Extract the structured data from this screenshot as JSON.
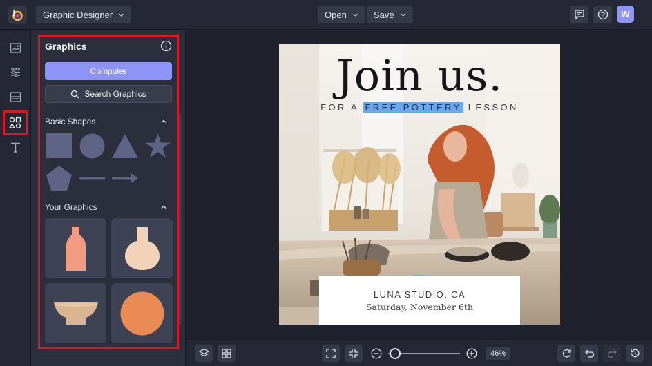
{
  "topbar": {
    "app_name": "Graphic Designer",
    "open_label": "Open",
    "save_label": "Save",
    "avatar_initial": "W"
  },
  "rail": {
    "items": [
      "image-icon",
      "sliders-icon",
      "layout-icon",
      "shapes-icon",
      "text-icon"
    ],
    "active_item": "shapes-icon"
  },
  "panel": {
    "title": "Graphics",
    "computer_button": "Computer",
    "search_button": "Search Graphics",
    "basic_shapes_title": "Basic Shapes",
    "basic_shapes": [
      "square",
      "circle",
      "triangle",
      "star",
      "pentagon",
      "line",
      "arrow"
    ],
    "your_graphics_title": "Your Graphics",
    "your_graphics": [
      "bottle-vase",
      "round-vase",
      "bowl",
      "circle-orange"
    ]
  },
  "design": {
    "headline": "Join us.",
    "sub_prefix": "FOR A",
    "sub_highlight": "FREE POTTERY",
    "sub_suffix": "LESSON",
    "card_line1": "LUNA STUDIO, CA",
    "card_line2": "Saturday, November 6th"
  },
  "bottombar": {
    "zoom": "46%"
  },
  "colors": {
    "accent": "#8d93f7",
    "highlight": "#6aa8ee",
    "shape_fill": "#5f6385",
    "annotation_red": "#e3141b"
  }
}
